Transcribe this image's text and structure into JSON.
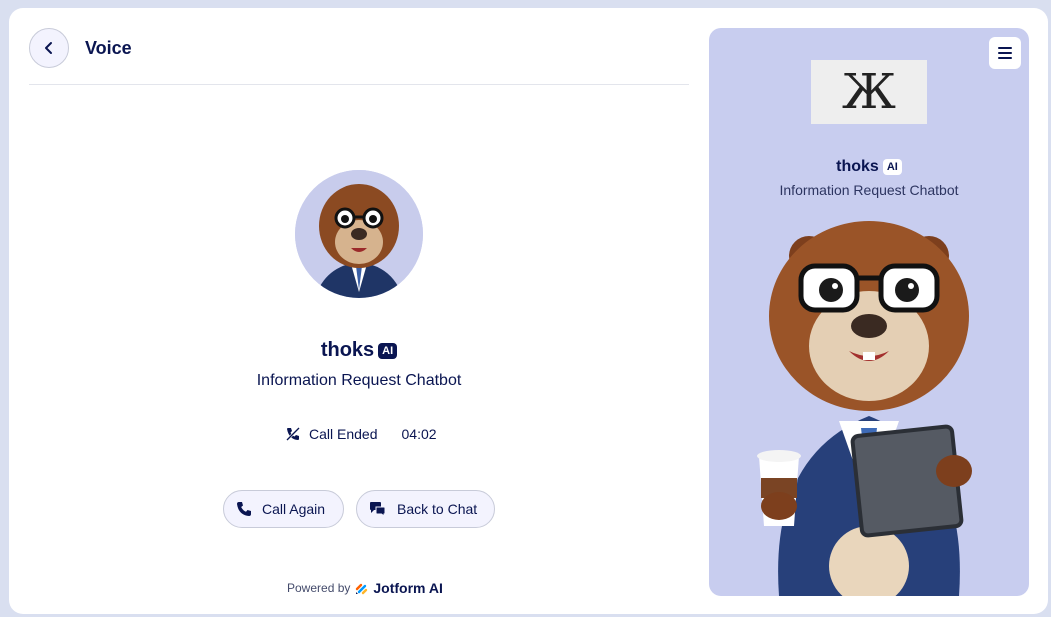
{
  "header": {
    "title": "Voice"
  },
  "agent": {
    "name": "thoks",
    "badge": "AI",
    "role": "Information Request Chatbot"
  },
  "call": {
    "status": "Call Ended",
    "duration": "04:02"
  },
  "actions": {
    "call_again": "Call Again",
    "back_to_chat": "Back to Chat"
  },
  "footer": {
    "powered_by": "Powered by",
    "brand": "Jotform AI"
  },
  "panel": {
    "logo_text": "Ж"
  },
  "icons": [
    "back-icon",
    "call-ended-icon",
    "phone-icon",
    "chat-icon",
    "menu-icon",
    "jotform-logo-icon"
  ],
  "colors": {
    "primary": "#0a1551",
    "panel_bg": "#c8cdef",
    "button_bg": "#f3f3fe"
  }
}
